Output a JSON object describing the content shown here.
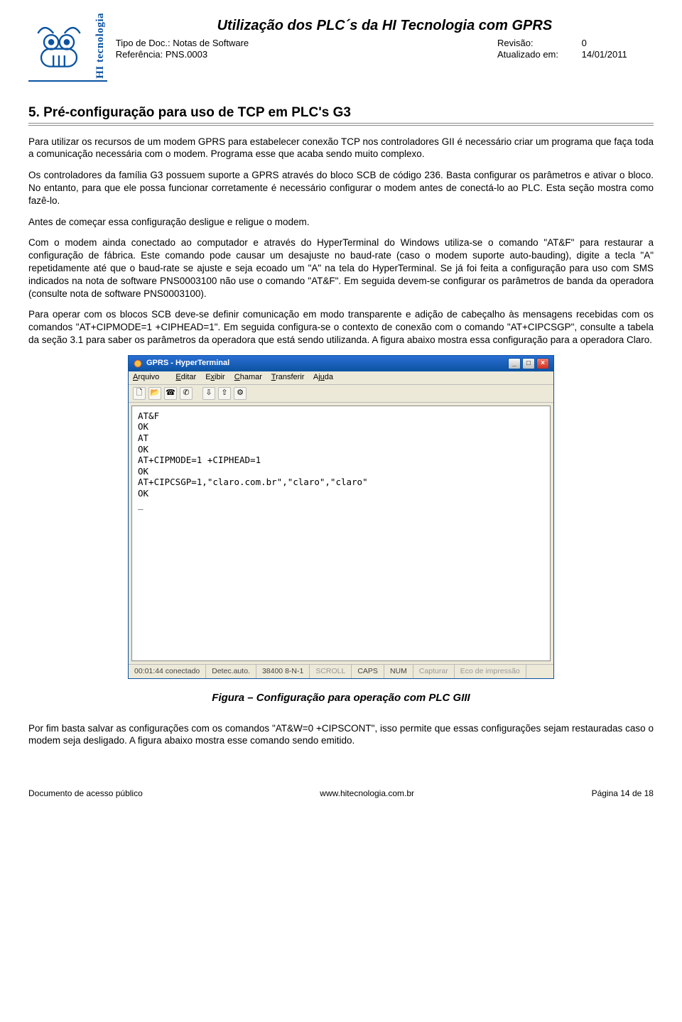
{
  "header": {
    "brand_vertical": "HI tecnologia",
    "doc_title": "Utilização dos PLC´s da HI Tecnologia com GPRS",
    "meta": {
      "tipo_label": "Tipo de Doc.:",
      "tipo_value": "Notas de Software",
      "ref_label": "Referência:",
      "ref_value": "PNS.0003",
      "rev_label": "Revisão:",
      "rev_value": "0",
      "atual_label": "Atualizado em:",
      "atual_value": "14/01/2011"
    }
  },
  "section": {
    "heading": "5. Pré-configuração para uso de TCP em PLC's G3",
    "p1": "Para utilizar os recursos de um modem GPRS para estabelecer conexão TCP nos controladores GII é necessário criar um programa que faça toda a comunicação necessária com o modem. Programa esse que acaba sendo muito complexo.",
    "p2": "Os controladores da família G3 possuem suporte a GPRS através do bloco SCB de código 236. Basta configurar os parâmetros e ativar o bloco. No entanto, para que ele possa funcionar corretamente é necessário configurar o modem antes de conectá-lo ao PLC. Esta seção mostra como fazê-lo.",
    "p3": "Antes de começar essa configuração desligue e religue o modem.",
    "p4": "Com o modem ainda conectado ao computador e através do HyperTerminal do Windows utiliza-se o comando \"AT&F\" para restaurar a configuração de fábrica. Este comando pode causar um desajuste no baud-rate (caso o modem suporte auto-bauding), digite a tecla \"A\" repetidamente até que o baud-rate se ajuste e seja ecoado um \"A\" na tela do HyperTerminal. Se já foi feita a configuração para uso com SMS indicados na nota de software PNS0003100 não use o comando \"AT&F\". Em seguida devem-se configurar os parâmetros de banda da operadora (consulte nota de software PNS0003100).",
    "p5": "Para operar com os blocos SCB deve-se definir comunicação em modo transparente e adição de cabeçalho às mensagens recebidas com os comandos \"AT+CIPMODE=1 +CIPHEAD=1\". Em seguida configura-se o contexto de conexão com o comando \"AT+CIPCSGP\", consulte a tabela da seção 3.1 para saber os parâmetros da operadora que está sendo utilizanda. A figura abaixo mostra essa configuração para a operadora Claro.",
    "figure_caption": "Figura – Configuração para operação com PLC GIII",
    "p6": "Por fim basta salvar as configurações com os comandos \"AT&W=0 +CIPSCONT\", isso permite que essas configurações sejam restauradas caso o modem seja desligado. A figura abaixo mostra esse comando sendo emitido."
  },
  "ht": {
    "title": "GPRS - HyperTerminal",
    "menus": [
      "Arquivo",
      "Editar",
      "Exibir",
      "Chamar",
      "Transferir",
      "Ajuda"
    ],
    "body_text": "AT&F\nOK\nAT\nOK\nAT+CIPMODE=1 +CIPHEAD=1\nOK\nAT+CIPCSGP=1,\"claro.com.br\",\"claro\",\"claro\"\nOK\n_",
    "status": {
      "time": "00:01:44 conectado",
      "detect": "Detec.auto.",
      "link": "38400 8-N-1",
      "scroll": "SCROLL",
      "caps": "CAPS",
      "num": "NUM",
      "capture": "Capturar",
      "echo": "Eco de impressão"
    }
  },
  "footer": {
    "left": "Documento de acesso público",
    "center": "www.hitecnologia.com.br",
    "right": "Página 14 de 18"
  }
}
